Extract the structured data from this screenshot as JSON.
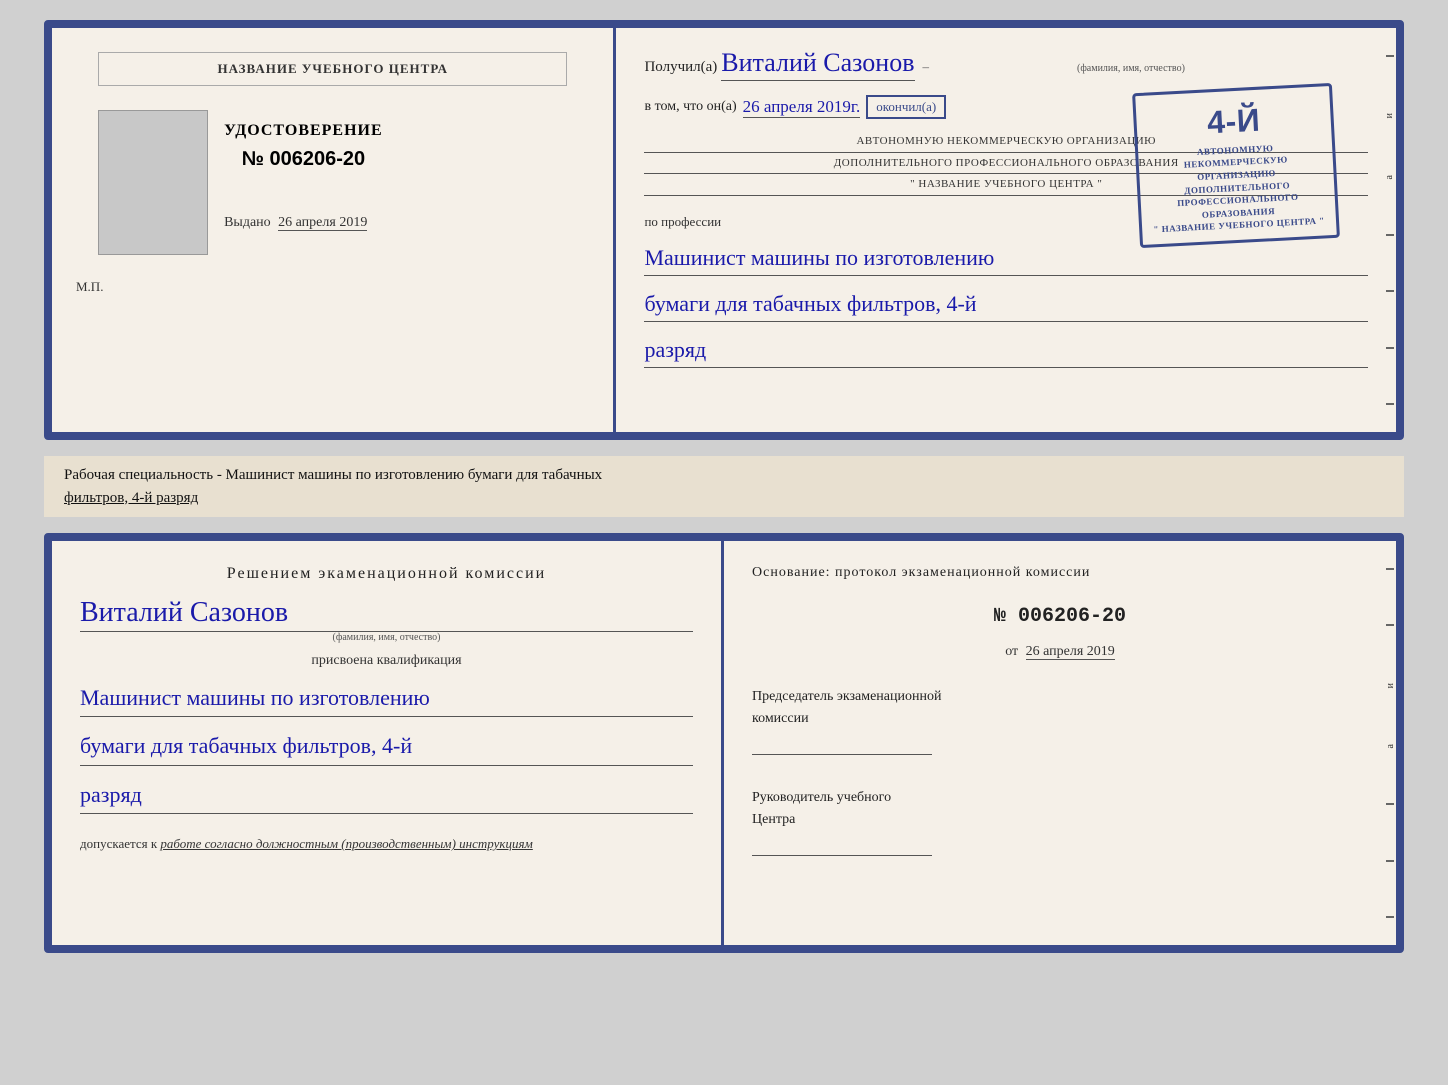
{
  "top_doc": {
    "left": {
      "training_center_label": "НАЗВАНИЕ УЧЕБНОГО ЦЕНТРА",
      "udostoverenie_title": "УДОСТОВЕРЕНИЕ",
      "cert_number": "№ 006206-20",
      "vydano_label": "Выдано",
      "vydano_date": "26 апреля 2019",
      "mp_label": "М.П."
    },
    "right": {
      "poluchil_prefix": "Получил(а)",
      "recipient_name": "Виталий Сазонов",
      "recipient_subtitle": "(фамилия, имя, отчество)",
      "vtom_prefix": "в том, что он(а)",
      "date_written": "26 апреля 2019г.",
      "okonchil_label": "окончил(а)",
      "stamp_num": "4-й",
      "stamp_line1": "АВТОНОМНУЮ НЕКОММЕРЧЕСКУЮ ОРГАНИЗАЦИЮ",
      "stamp_line2": "ДОПОЛНИТЕЛЬНОГО ПРОФЕССИОНАЛЬНОГО ОБРАЗОВАНИЯ",
      "stamp_line3": "\" НАЗВАНИЕ УЧЕБНОГО ЦЕНТРА \"",
      "po_professii_label": "по профессии",
      "profession_line1": "Машинист машины по изготовлению",
      "profession_line2": "бумаги для табачных фильтров, 4-й",
      "profession_line3": "разряд"
    }
  },
  "middle_strip": {
    "text_prefix": "Рабочая специальность - Машинист машины по изготовлению бумаги для табачных",
    "text_underline": "фильтров, 4-й разряд"
  },
  "bottom_doc": {
    "left": {
      "komissia_title": "Решением экаменационной комиссии",
      "recipient_name": "Виталий Сазонов",
      "recipient_subtitle": "(фамилия, имя, отчество)",
      "prisvoena_label": "присвоена квалификация",
      "profession_line1": "Машинист машины по изготовлению",
      "profession_line2": "бумаги для табачных фильтров, 4-й",
      "profession_line3": "разряд",
      "dopuskaetsya_prefix": "допускается к",
      "dopuskaetsya_text": "работе согласно должностным (производственным) инструкциям"
    },
    "right": {
      "osnova_label": "Основание: протокол экзаменационной комиссии",
      "protocol_number": "№ 006206-20",
      "ot_label": "от",
      "ot_date": "26 апреля 2019",
      "predsedatel_line1": "Председатель экзаменационной",
      "predsedatel_line2": "комиссии",
      "rukovoditel_line1": "Руководитель учебного",
      "rukovoditel_line2": "Центра"
    }
  },
  "edge_deco": {
    "text_i": "и",
    "text_a": "а",
    "text_arrow": "←"
  }
}
